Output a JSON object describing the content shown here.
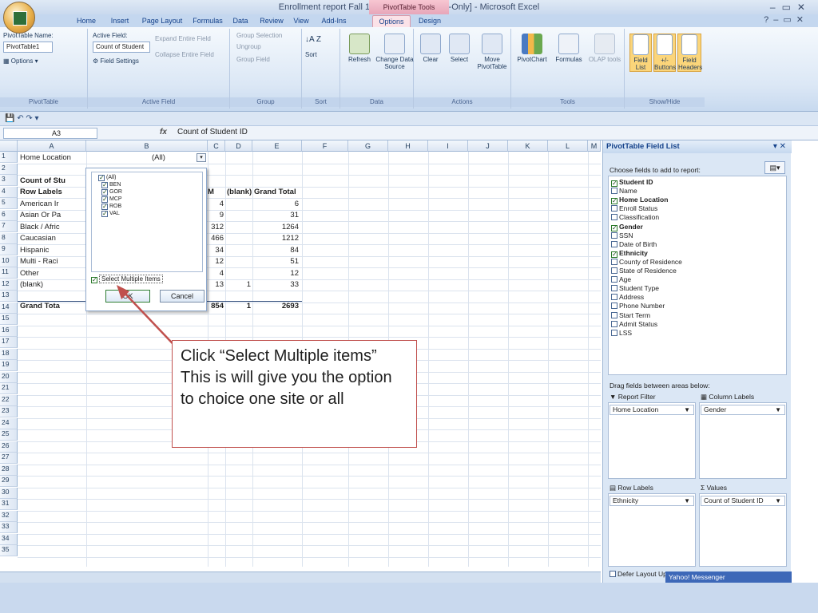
{
  "app": {
    "title": "Enrollment report Fall 1 2010 (2).xlsx  [Read-Only] - Microsoft Excel",
    "context_tab_group": "PivotTable Tools"
  },
  "tabs": [
    "Home",
    "Insert",
    "Page Layout",
    "Formulas",
    "Data",
    "Review",
    "View",
    "Add-Ins",
    "Options",
    "Design"
  ],
  "active_tab": "Options",
  "ribbon": {
    "pivottable": {
      "name_label": "PivotTable Name:",
      "name_value": "PivotTable1",
      "options_label": "Options",
      "group_label": "PivotTable"
    },
    "active_field": {
      "label": "Active Field:",
      "value": "Count of Student",
      "field_settings": "Field Settings",
      "expand": "Expand Entire Field",
      "collapse": "Collapse Entire Field",
      "group_label": "Active Field"
    },
    "group": {
      "selection": "Group Selection",
      "ungroup": "Ungroup",
      "field": "Group Field",
      "group_label": "Group"
    },
    "sort": {
      "sort_label": "Sort",
      "group_label": "Sort"
    },
    "data": {
      "refresh": "Refresh",
      "change_source": "Change Data Source",
      "group_label": "Data"
    },
    "actions": {
      "clear": "Clear",
      "select": "Select",
      "move": "Move PivotTable",
      "group_label": "Actions"
    },
    "tools": {
      "pivotchart": "PivotChart",
      "formulas": "Formulas",
      "olap": "OLAP tools",
      "group_label": "Tools"
    },
    "showhide": {
      "field_list": "Field List",
      "buttons": "+/- Buttons",
      "headers": "Field Headers",
      "group_label": "Show/Hide"
    }
  },
  "formula_bar": {
    "name_box": "A3",
    "fx": "fx",
    "content": "Count of Student ID"
  },
  "columns": [
    "A",
    "B",
    "C",
    "D",
    "E",
    "F",
    "G",
    "H",
    "I",
    "J",
    "K",
    "L",
    "M"
  ],
  "rows": [
    "1",
    "2",
    "3",
    "4",
    "5",
    "6",
    "7",
    "8",
    "9",
    "10",
    "11",
    "12",
    "13",
    "14",
    "15",
    "16",
    "17",
    "18",
    "19",
    "20",
    "21",
    "22",
    "23",
    "24",
    "25",
    "26",
    "27",
    "28",
    "29",
    "30",
    "31",
    "32",
    "33",
    "34",
    "35"
  ],
  "pivot": {
    "filter_label": "Home Location",
    "filter_value": "(All)",
    "a3": "Count of Stu",
    "header": {
      "row_labels": "Row Labels",
      "m": "M",
      "blank": "(blank)",
      "grand_total": "Grand Total"
    },
    "rows": [
      {
        "label": "American Ir",
        "m": "4",
        "blank": "",
        "total": "6"
      },
      {
        "label": "Asian Or Pa",
        "m": "9",
        "blank": "",
        "total": "31"
      },
      {
        "label": "Black / Afric",
        "m": "312",
        "blank": "",
        "total": "1264"
      },
      {
        "label": "Caucasian",
        "m": "466",
        "blank": "",
        "total": "1212"
      },
      {
        "label": "Hispanic",
        "m": "34",
        "blank": "",
        "total": "84"
      },
      {
        "label": "Multi - Raci",
        "m": "12",
        "blank": "",
        "total": "51"
      },
      {
        "label": "Other",
        "m": "4",
        "blank": "",
        "total": "12"
      },
      {
        "label": "(blank)",
        "m": "13",
        "blank": "1",
        "total": "33"
      }
    ],
    "grand": {
      "label": "Grand Tota",
      "m": "854",
      "blank": "1",
      "total": "2693"
    }
  },
  "filter_dropdown": {
    "items": [
      "(All)",
      "BEN",
      "GOR",
      "MCP",
      "ROB",
      "VAL"
    ],
    "select_multiple": "Select Multiple Items",
    "ok": "OK",
    "cancel": "Cancel"
  },
  "callout": "Click “Select Multiple items”  This is will give you the option to choice one site or all",
  "field_list": {
    "title": "PivotTable Field List",
    "choose_label": "Choose fields to add to report:",
    "fields": [
      {
        "name": "Student ID",
        "checked": true
      },
      {
        "name": "Name",
        "checked": false
      },
      {
        "name": "Home Location",
        "checked": true
      },
      {
        "name": "Enroll Status",
        "checked": false
      },
      {
        "name": "Classification",
        "checked": false
      },
      {
        "name": "Gender",
        "checked": true
      },
      {
        "name": "SSN",
        "checked": false
      },
      {
        "name": "Date of Birth",
        "checked": false
      },
      {
        "name": "Ethnicity",
        "checked": true
      },
      {
        "name": "County of Residence",
        "checked": false
      },
      {
        "name": "State of Residence",
        "checked": false
      },
      {
        "name": "Age",
        "checked": false
      },
      {
        "name": "Student Type",
        "checked": false
      },
      {
        "name": "Address",
        "checked": false
      },
      {
        "name": "Phone Number",
        "checked": false
      },
      {
        "name": "Start Term",
        "checked": false
      },
      {
        "name": "Admit Status",
        "checked": false
      },
      {
        "name": "LSS",
        "checked": false
      }
    ],
    "drag_label": "Drag fields between areas below:",
    "report_filter": "Report Filter",
    "column_labels": "Column Labels",
    "row_labels": "Row Labels",
    "values": "Values",
    "rf_value": "Home Location",
    "cl_value": "Gender",
    "rl_value": "Ethnicity",
    "v_value": "Count of Student ID",
    "defer": "Defer Layout Update",
    "yahoo": "Yahoo! Messenger"
  }
}
